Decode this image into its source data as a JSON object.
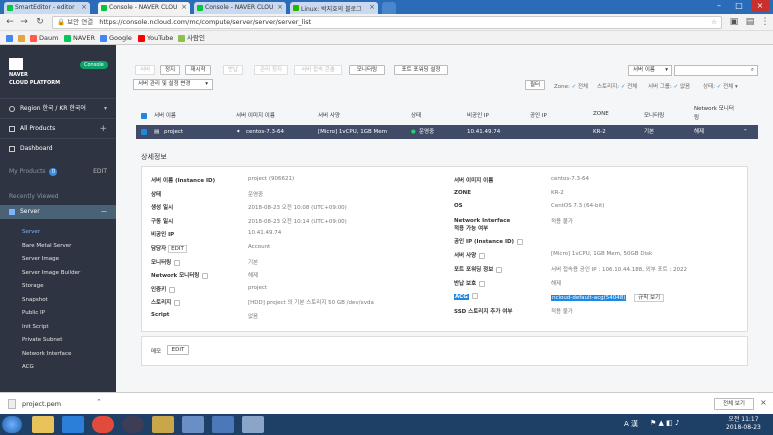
{
  "browser": {
    "tabs": [
      {
        "label": "SmartEditor - editor",
        "favicon_color": "#00c73c"
      },
      {
        "label": "Console - NAVER CLOU",
        "favicon_color": "#00c73c",
        "active": true
      },
      {
        "label": "Console - NAVER CLOU",
        "favicon_color": "#00c73c"
      },
      {
        "label": "Linux: 박지호의 블로그",
        "favicon_color": "#2db400"
      }
    ],
    "secure_label": "보안 연결",
    "url": "https://console.ncloud.com/mc/compute/server/server/server_list",
    "bookmarks": [
      {
        "label": "앱",
        "color": "#4285f4"
      },
      {
        "label": "Daum",
        "color": "#ff5a4a"
      },
      {
        "label": "NAVER",
        "color": "#03c75a"
      },
      {
        "label": "Google",
        "color": "#4285f4"
      },
      {
        "label": "YouTube",
        "color": "#ff0000"
      },
      {
        "label": "사람인",
        "color": "#8bc34a"
      }
    ]
  },
  "sidebar": {
    "logo_line1": "NAVER",
    "logo_line2": "CLOUD PLATFORM",
    "console_badge": "Console",
    "region": "Region 한국 / KR 한국어",
    "all_products": "All Products",
    "dashboard": "Dashboard",
    "my_products": "My Products",
    "my_products_count": "0",
    "edit": "EDIT",
    "recently_viewed": "Recently Viewed",
    "server_section": "Server",
    "items": [
      "Server",
      "Bare Metal Server",
      "Server Image",
      "Server Image Builder",
      "Storage",
      "Snapshot",
      "Public IP",
      "Init Script",
      "Private Subnet",
      "Network Interface",
      "ACG"
    ]
  },
  "toolbar": {
    "buttons": [
      "서버",
      "정지",
      "재시작",
      "반납",
      "관리 정지",
      "서버 접속 콘솔",
      "모니터링",
      "포트 포워딩 설정"
    ],
    "disabled": [
      true,
      false,
      false,
      true,
      true,
      true,
      false,
      false
    ],
    "manage_select": "서버 관리 및 설정 변경",
    "search_select": "서버 이름",
    "filter_btn": "필터",
    "zone_label": "Zone:",
    "zone_value": "전체",
    "storage_label": "스토리지:",
    "storage_value": "전체",
    "server_group_label": "서버 그룹:",
    "server_group_value": "없음",
    "status_label": "상태:",
    "status_value": "전체"
  },
  "table": {
    "headers": [
      "서버 이름",
      "서버 이미지 이름",
      "서버 사양",
      "상태",
      "비공인 IP",
      "공인 IP",
      "ZONE",
      "모니터링",
      "Network 모니터링"
    ],
    "row": {
      "name": "project",
      "image": "centos-7.3-64",
      "spec": "[Micro] 1vCPU, 1GB Mem",
      "status": "운영중",
      "private_ip": "10.41.49.74",
      "public_ip": "",
      "zone": "KR-2",
      "monitoring": "기본",
      "net_monitoring": "해제"
    }
  },
  "detail": {
    "title": "상세정보",
    "left": [
      {
        "label": "서버 이름 (Instance ID)",
        "value": "project (906621)"
      },
      {
        "label": "상태",
        "value": "운영중"
      },
      {
        "label": "생성 일시",
        "value": "2018-08-23 오전 10:08 (UTC+09:00)"
      },
      {
        "label": "구동 일시",
        "value": "2018-08-23 오전 10:14 (UTC+09:00)"
      },
      {
        "label": "비공인 IP",
        "value": "10.41.49.74"
      },
      {
        "label": "담당자",
        "value": "Account",
        "extra": "EDIT"
      },
      {
        "label": "모니터링",
        "value": "기본"
      },
      {
        "label": "Network 모니터링",
        "value": "해제"
      },
      {
        "label": "인증키",
        "value": "project"
      },
      {
        "label": "스토리지",
        "value": "[HDD] project 의 기본 스토리지 50 GB /dev/xvda"
      },
      {
        "label": "Script",
        "value": "없음"
      }
    ],
    "right": [
      {
        "label": "서버 이미지 이름",
        "value": "centos-7.3-64"
      },
      {
        "label": "ZONE",
        "value": "KR-2"
      },
      {
        "label": "OS",
        "value": "CentOS 7.3 (64-bit)"
      },
      {
        "label": "Network Interface 적용 가능 여부",
        "value": "적용 불가"
      },
      {
        "label": "공인 IP (Instance ID)",
        "value": ""
      },
      {
        "label": "서버 사양",
        "value": "[Micro] 1vCPU, 1GB Mem, 50GB Disk"
      },
      {
        "label": "포트 포워딩 정보",
        "value": "서버 접속용 공인 IP : 106.10.44.188, 외부 포트 : 2022"
      },
      {
        "label": "반납 보호",
        "value": "해제"
      },
      {
        "label": "ACG",
        "value": "ncloud-default-acg(54048)",
        "extra": "규칙 보기"
      },
      {
        "label": "SSD 스토리지 추가 여부",
        "value": "적용 불가"
      }
    ],
    "memo_label": "메모",
    "memo_edit": "EDIT"
  },
  "download": {
    "filename": "project.pem",
    "show_all": "전체 보기"
  },
  "taskbar": {
    "time": "오전 11:17",
    "date": "2018-08-23",
    "ime": "A 漢"
  }
}
